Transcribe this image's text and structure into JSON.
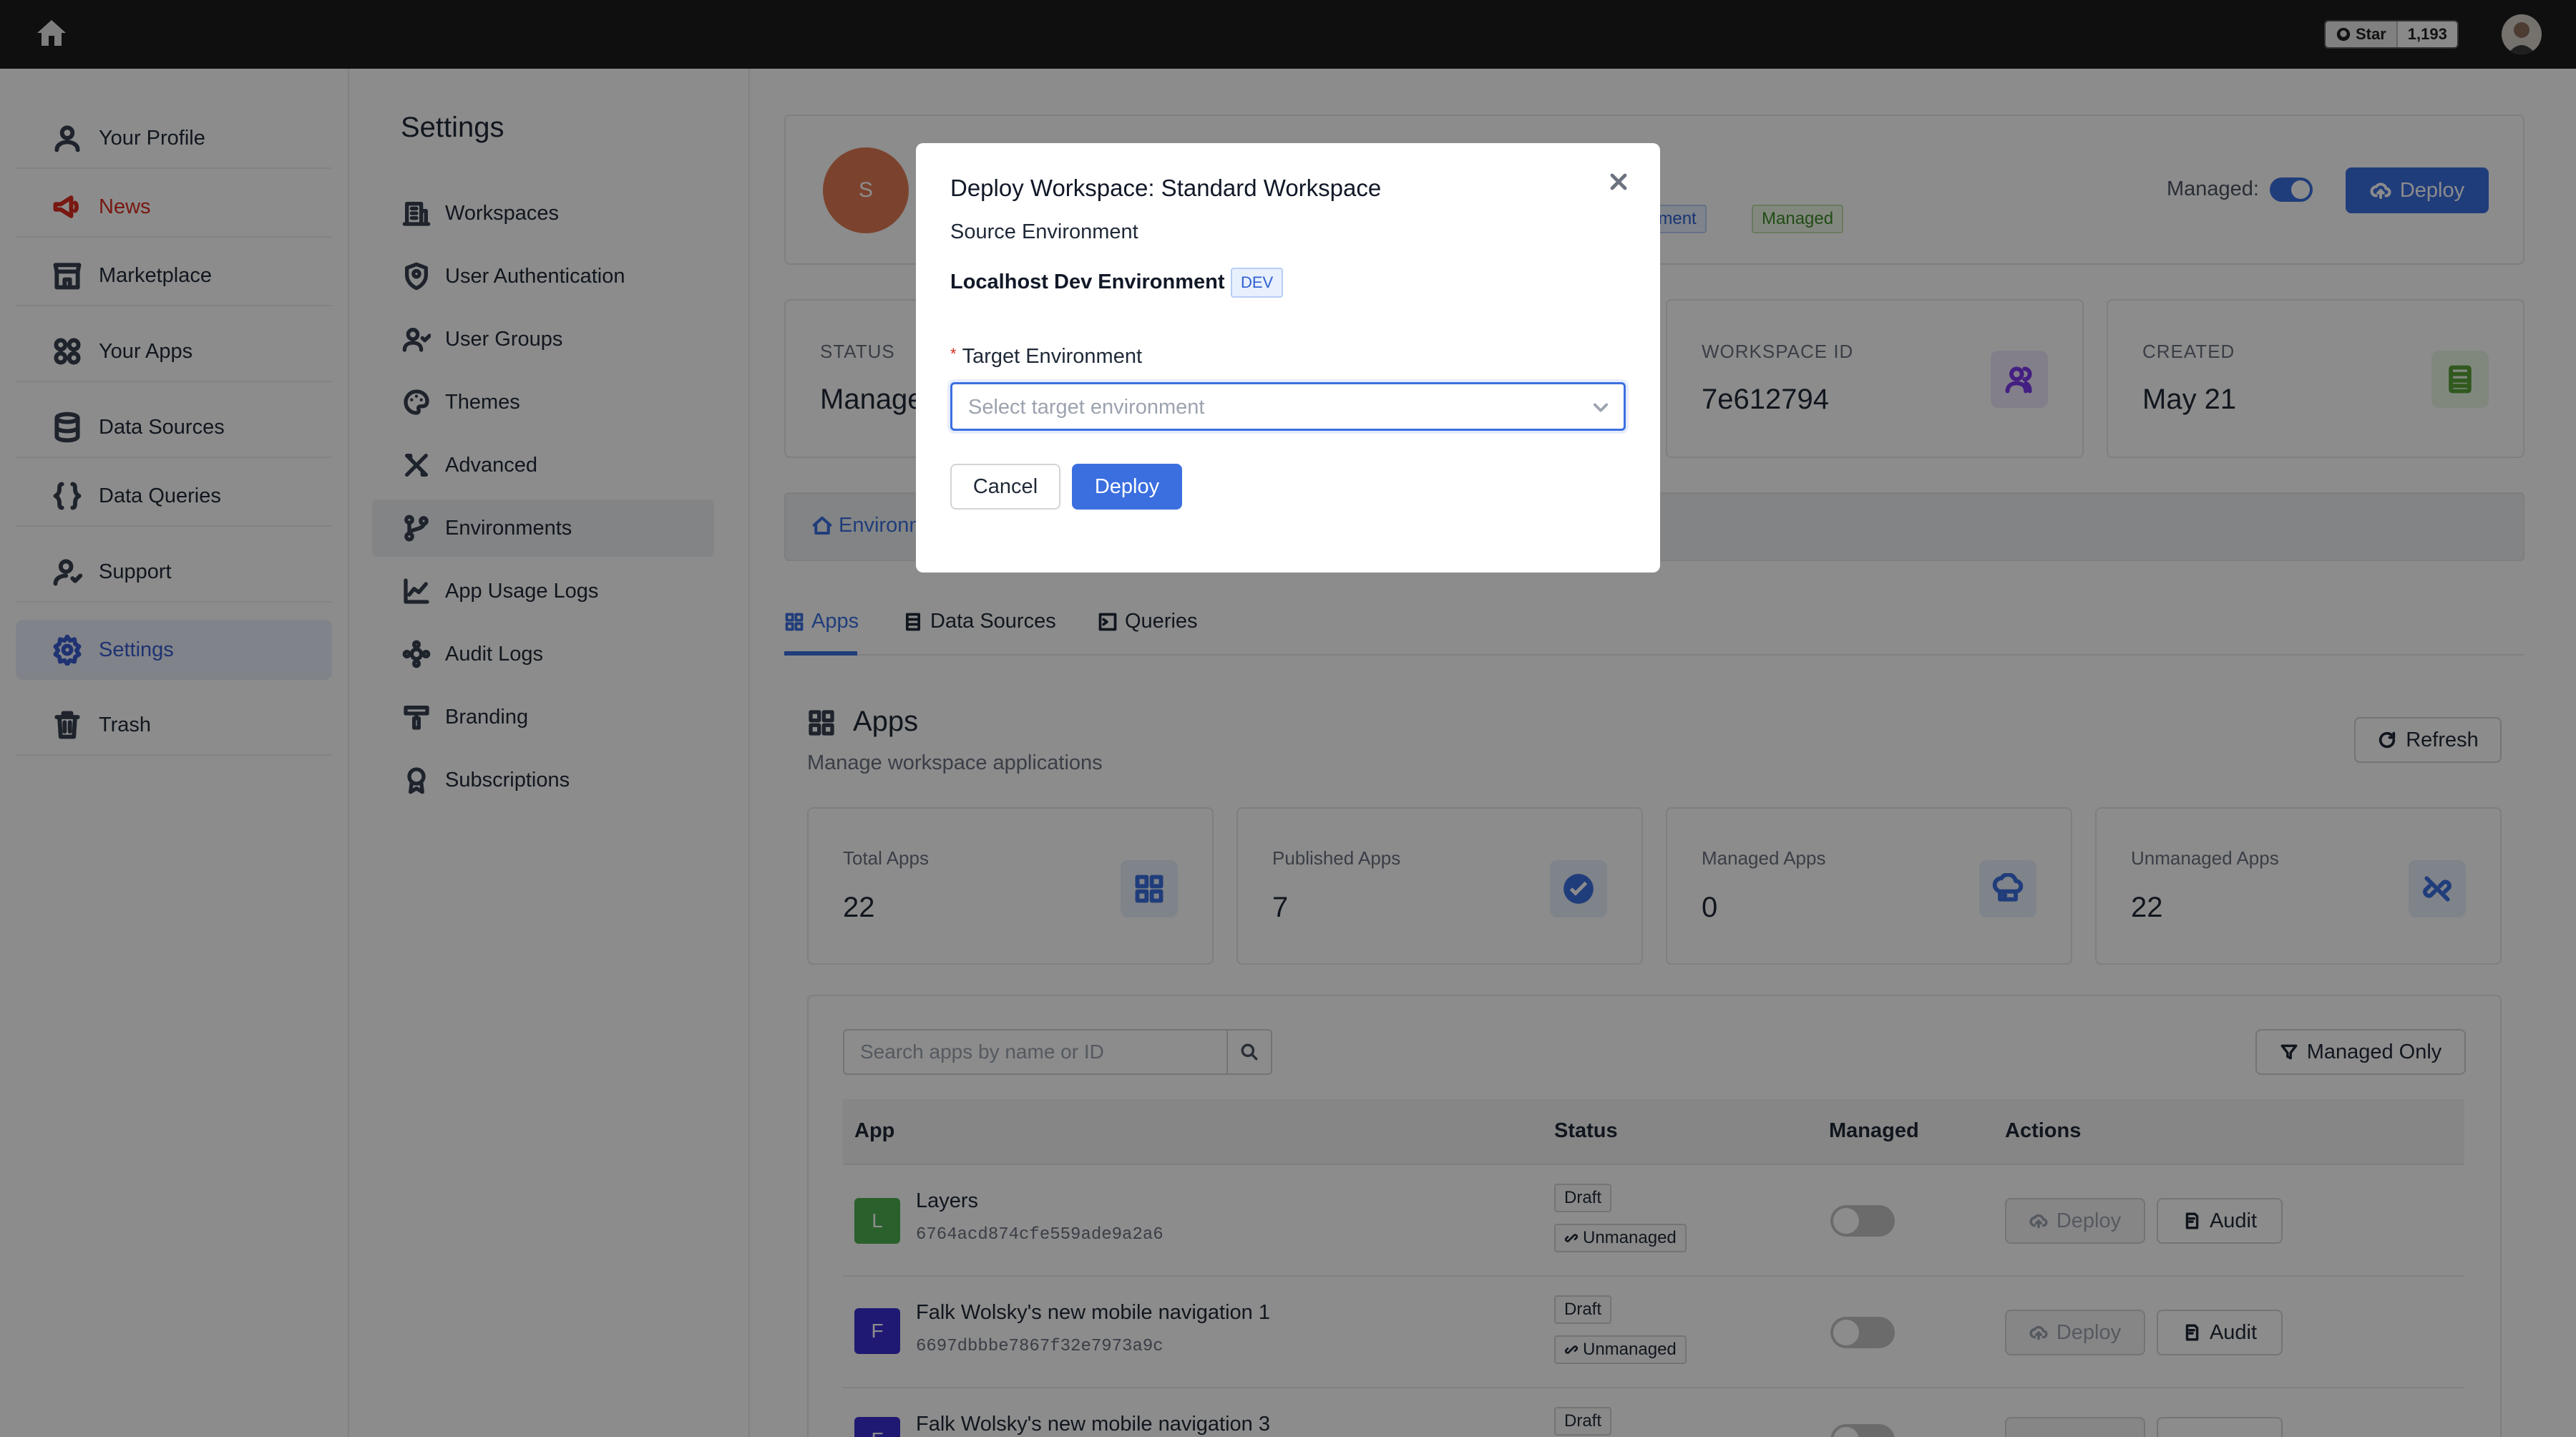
{
  "topbar": {
    "github_star_label": "Star",
    "github_star_count": "1,193"
  },
  "nav": {
    "items": [
      {
        "label": "Your Profile"
      },
      {
        "label": "News"
      },
      {
        "label": "Marketplace"
      },
      {
        "label": "Your Apps"
      },
      {
        "label": "Data Sources"
      },
      {
        "label": "Data Queries"
      },
      {
        "label": "Support"
      },
      {
        "label": "Settings"
      },
      {
        "label": "Trash"
      }
    ]
  },
  "settings_menu": {
    "title": "Settings",
    "items": [
      {
        "label": "Workspaces"
      },
      {
        "label": "User Authentication"
      },
      {
        "label": "User Groups"
      },
      {
        "label": "Themes"
      },
      {
        "label": "Advanced"
      },
      {
        "label": "Environments"
      },
      {
        "label": "App Usage Logs"
      },
      {
        "label": "Audit Logs"
      },
      {
        "label": "Branding"
      },
      {
        "label": "Subscriptions"
      }
    ]
  },
  "workspace_header": {
    "avatar_letter": "S",
    "badge_env_partial": "nment",
    "badge_managed": "Managed",
    "managed_label": "Managed:",
    "deploy_label": "Deploy"
  },
  "info_cards": {
    "status_label": "STATUS",
    "status_value_partial": "Manage",
    "workspace_id_label": "WORKSPACE ID",
    "workspace_id_value": "7e612794",
    "created_label": "CREATED",
    "created_value": "May 21"
  },
  "breadcrumb": {
    "label_partial": "Environm"
  },
  "tabs": [
    {
      "label": "Apps"
    },
    {
      "label": "Data Sources"
    },
    {
      "label": "Queries"
    }
  ],
  "apps_section": {
    "title": "Apps",
    "subtitle": "Manage workspace applications",
    "refresh_label": "Refresh",
    "stats": [
      {
        "label": "Total Apps",
        "value": "22"
      },
      {
        "label": "Published Apps",
        "value": "7"
      },
      {
        "label": "Managed Apps",
        "value": "0"
      },
      {
        "label": "Unmanaged Apps",
        "value": "22"
      }
    ],
    "search_placeholder": "Search apps by name or ID",
    "filter_label": "Managed Only",
    "columns": [
      "App",
      "Status",
      "Managed",
      "Actions"
    ],
    "rows": [
      {
        "letter": "L",
        "name": "Layers",
        "id": "6764acd874cfe559ade9a2a6",
        "status": "Draft",
        "managed_status": "Unmanaged",
        "deploy": "Deploy",
        "audit": "Audit",
        "avatar_color": "#4caf50"
      },
      {
        "letter": "F",
        "name": "Falk Wolsky's new mobile navigation 1",
        "id": "6697dbbbe7867f32e7973a9c",
        "status": "Draft",
        "managed_status": "Unmanaged",
        "deploy": "Deploy",
        "audit": "Audit",
        "avatar_color": "#3b2fd1"
      },
      {
        "letter": "F",
        "name": "Falk Wolsky's new mobile navigation 3",
        "status": "Draft",
        "avatar_color": "#3b2fd1"
      }
    ]
  },
  "modal": {
    "title": "Deploy Workspace: Standard Workspace",
    "source_label": "Source Environment",
    "source_env_name": "Localhost Dev Environment",
    "source_env_tag": "DEV",
    "target_required_mark": "*",
    "target_label": "Target Environment",
    "target_placeholder": "Select target environment",
    "cancel_label": "Cancel",
    "deploy_label": "Deploy"
  },
  "colors": {
    "accent": "#3b6fe0",
    "danger": "#d92d20",
    "topbar": "#1c1c1e"
  }
}
